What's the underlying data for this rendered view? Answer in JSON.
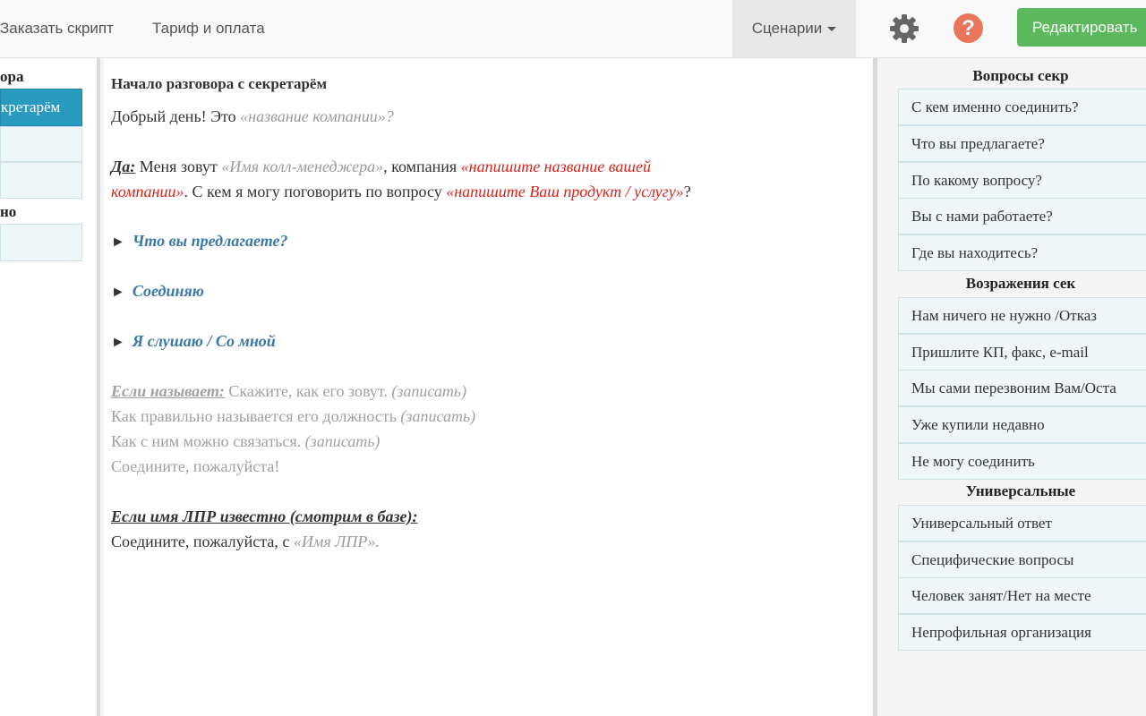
{
  "nav": {
    "order_script": "Заказать скрипт",
    "tariff": "Тариф и оплата",
    "scenarios": "Сценарии",
    "help_glyph": "?",
    "edit": "Редактировать"
  },
  "left": {
    "section1": "ора",
    "item_active": "кретарём",
    "section2": "но"
  },
  "script": {
    "title": "Начало разговора с секретарём",
    "greeting": "Добрый день! Это ",
    "company_ph": "«название компании»",
    "qmark": "?",
    "yes_label": "Да:",
    "yes_t1": " Меня зовут ",
    "manager_ph": "«Имя колл-менеджера»",
    "yes_t2": ", компания ",
    "own_company_ph1": "«напишите название вашей",
    "own_company_ph2": "компании»",
    "yes_t3": ". С кем я могу поговорить по вопросу ",
    "product_ph": "«напишите Ваш продукт / услугу»",
    "yes_end": "?",
    "arrow_glyph": "►",
    "branches": [
      "Что вы предлагаете?",
      "Соединяю",
      "Я слушаю / Со мной"
    ],
    "if_named_label": "Если называет:",
    "if_named_t1": " Скажите, как его зовут. ",
    "record": "(записать)",
    "if_named_t2": "Как правильно называется его должность ",
    "if_named_t3": "Как с ним можно связаться. ",
    "if_named_t4": "Соедините, пожалуйста!",
    "if_known_label": "Если имя ЛПР известно (смотрим в базе):",
    "if_known_t1": "Соедините, пожалуйста, с ",
    "dm_ph": "«Имя ЛПР»",
    "period": "."
  },
  "right": {
    "questions_title": "Вопросы секр",
    "questions": [
      "С кем именно соединить?",
      "Что вы предлагаете?",
      "По какому вопросу?",
      "Вы с нами работаете?",
      "Где вы находитесь?"
    ],
    "objections_title": "Возражения сек",
    "objections": [
      "Нам ничего не нужно /Отказ",
      "Пришлите КП, факс, e-mail",
      "Мы сами перезвоним Вам/Оста",
      "Уже купили недавно",
      "Не могу соединить"
    ],
    "universal_title": "Универсальные",
    "universal": [
      "Универсальный ответ",
      "Специфические вопросы",
      "Человек занят/Нет на месте",
      "Непрофильная организация"
    ]
  },
  "icons": {
    "settings": "gear-icon",
    "help": "help-icon"
  },
  "colors": {
    "accent_blue": "#2a9bc0",
    "edit_green": "#5cb85c",
    "help_orange": "#e9765a",
    "placeholder_red": "#d9231b",
    "link_blue": "#3a78a8"
  }
}
